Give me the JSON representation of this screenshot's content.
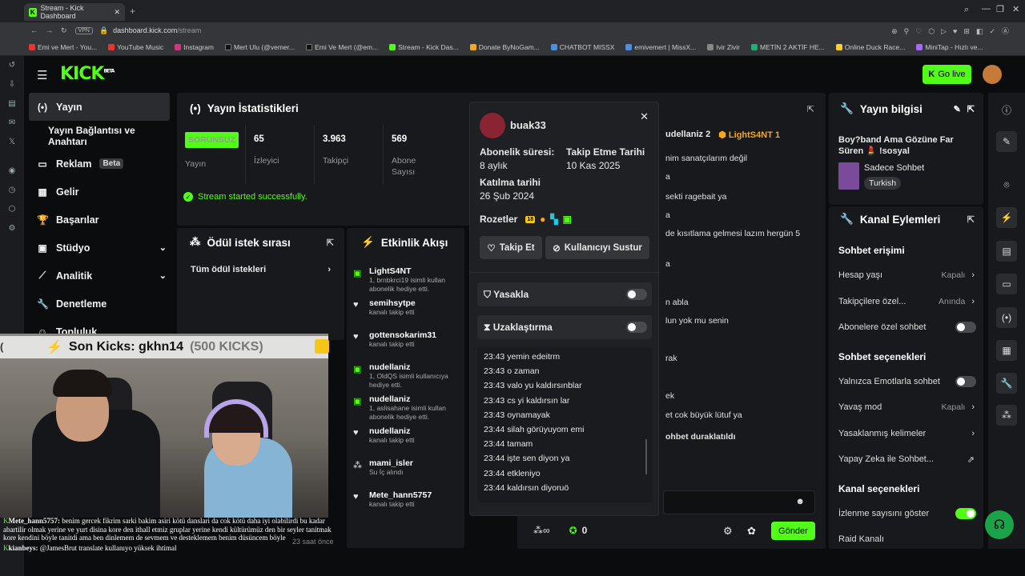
{
  "browser": {
    "tab_title": "Stream - Kick Dashboard",
    "url_domain": "dashboard.kick.com",
    "url_path": "/stream",
    "vpn": "VPN",
    "bookmarks": [
      "Emi ve Mert - You...",
      "YouTube Music",
      "Instagram",
      "Mert Ulu (@vemer...",
      "Emi Ve Mert (@em...",
      "Stream - Kick Das...",
      "Donate ByNoGam...",
      "CHATBOT MISSX",
      "emivemert | MissX...",
      "Ivir Zivir",
      "METİN 2 AKTİF HE...",
      "Online Duck Race...",
      "MiniTap - Hızlı ve..."
    ]
  },
  "header": {
    "logo": "KICK",
    "logo_sup": "BETA",
    "go_live": "Go live"
  },
  "sidebar": {
    "items": [
      {
        "label": "Yayın"
      },
      {
        "label": "Yayın Bağlantısı ve Anahtarı"
      },
      {
        "label": "Reklam",
        "badge": "Beta"
      },
      {
        "label": "Gelir"
      },
      {
        "label": "Başarılar"
      },
      {
        "label": "Stüdyo"
      },
      {
        "label": "Analitik"
      },
      {
        "label": "Denetleme"
      },
      {
        "label": "Topluluk"
      }
    ]
  },
  "stats": {
    "title": "Yayın İstatistikleri",
    "status_badge": "SORUNSUZ",
    "status_label": "Yayın",
    "viewers": "65",
    "viewers_label": "İzleyici",
    "followers": "3.963",
    "followers_label": "Takipçi",
    "subs": "569",
    "subs_label_1": "Abone",
    "subs_label_2": "Sayısı",
    "success": "Stream started successfully."
  },
  "reward": {
    "title": "Ödül istek sırası",
    "all_requests": "Tüm ödül istekleri"
  },
  "activity": {
    "title": "Etkinlik Akışı",
    "items": [
      {
        "name": "LightS4NT",
        "sub1": "1, brnbkrci19 isimli kullan",
        "sub2": "abonelik hediye etti."
      },
      {
        "name": "semihsytpe",
        "sub1": "kanalı takip etti",
        "sub2": ""
      },
      {
        "name": "gottensokarim31",
        "sub1": "kanalı takip etti",
        "sub2": ""
      },
      {
        "name": "nudellaniz",
        "sub1": "1, OldQS isimli kullanıcıya",
        "sub2": "hediye etti."
      },
      {
        "name": "nudellaniz",
        "sub1": "1, aslisahane isimli kullan",
        "sub2": "abonelik hediye etti."
      },
      {
        "name": "nudellaniz",
        "sub1": "kanalı takip etti",
        "sub2": ""
      },
      {
        "name": "mami_isler",
        "sub1": "Su İç alındı",
        "sub2": ""
      },
      {
        "name": "Mete_hann5757",
        "sub1": "kanalı takip etti",
        "sub2": ""
      }
    ],
    "footer_time": "23 saat önce"
  },
  "popup": {
    "username": "buak33",
    "sub_duration_label": "Abonelik süresi:",
    "sub_duration": "8 aylık",
    "follow_date_label": "Takip Etme Tarihi",
    "follow_date": "10 Kas 2025",
    "join_label": "Katılma tarihi",
    "join_date": "26 Şub 2024",
    "badges_label": "Rozetler",
    "follow_btn": "Takip Et",
    "mute_btn": "Kullanıcıyı Sustur",
    "ban": "Yasakla",
    "timeout": "Uzaklaştırma",
    "messages": [
      {
        "time": "23:43",
        "text": "yemin edeitrm"
      },
      {
        "time": "23:43",
        "text": "o zaman"
      },
      {
        "time": "23:43",
        "text": "valo yu kaldırsınblar"
      },
      {
        "time": "23:43",
        "text": "cs yi kaldırsın lar"
      },
      {
        "time": "23:43",
        "text": "oynamayak"
      },
      {
        "time": "23:44",
        "text": "silah görüyuyom emi"
      },
      {
        "time": "23:44",
        "text": "tamam"
      },
      {
        "time": "23:44",
        "text": "işte sen diyon ya"
      },
      {
        "time": "23:44",
        "text": "etkleniyo"
      },
      {
        "time": "23:44",
        "text": "kaldırsın diyoruö"
      }
    ]
  },
  "chat": {
    "top_users": [
      "udellaniz 2",
      "LightS4NT 1"
    ],
    "lines": [
      "nim sanatçılarım değil",
      "a",
      "sekti ragebait ya",
      "a",
      "de kısıtlama gelmesi lazım hergün 5",
      "a",
      "n abla",
      "lun yok mu senin",
      "rak",
      "ek",
      "et cok büyük lütuf ya",
      "ohbet duraklatıldı"
    ],
    "points": "0",
    "send": "Gönder"
  },
  "info": {
    "title": "Yayın bilgisi",
    "stream_title": "Boy?band Ama Gözüne Far Süren 💄 !sosyal",
    "category": "Sadece Sohbet",
    "language": "Turkish"
  },
  "kanal": {
    "title": "Kanal Eylemleri",
    "chat_access": "Sohbet erişimi",
    "age": "Hesap yaşı",
    "age_val": "Kapalı",
    "followers_only": "Takipçilere özel...",
    "followers_only_val": "Anında",
    "subs_only": "Abonelere özel sohbet",
    "chat_options": "Sohbet seçenekleri",
    "emote_only": "Yalnızca Emotlarla sohbet",
    "slow": "Yavaş mod",
    "slow_val": "Kapalı",
    "banned_words": "Yasaklanmış kelimeler",
    "ai": "Yapay Zeka ile Sohbet...",
    "channel_options": "Kanal seçenekleri",
    "view_count": "İzlenme sayısını göster",
    "raid": "Raid Kanalı"
  },
  "overlay": {
    "kicks_banner": "Son Kicks: gkhn14",
    "kicks_count": "(500 KICKS)",
    "chat_user1": "Mete_hann5757:",
    "chat_msg1": "benim gercek fikrim sarki bakim asiri kötü danslari da cok kötü daha iyi olabilirdi bu kadar abartilir olmak yerine ve yurt disina kore den ithall etmiz gruplar yerine kendi kültürümüz den bir seyler tanitmak kore kendini böyle tanitdi ama ben dinlemem de sevmem ve desteklemem benim düsüncem böyle",
    "chat_user2": "kianbeys:",
    "chat_msg2": "@JamesBrut translate kullanıyo yüksek ihtimal"
  },
  "colors": {
    "accent": "#53fc18",
    "panel": "#18191c",
    "bg": "#0b0c0e"
  }
}
